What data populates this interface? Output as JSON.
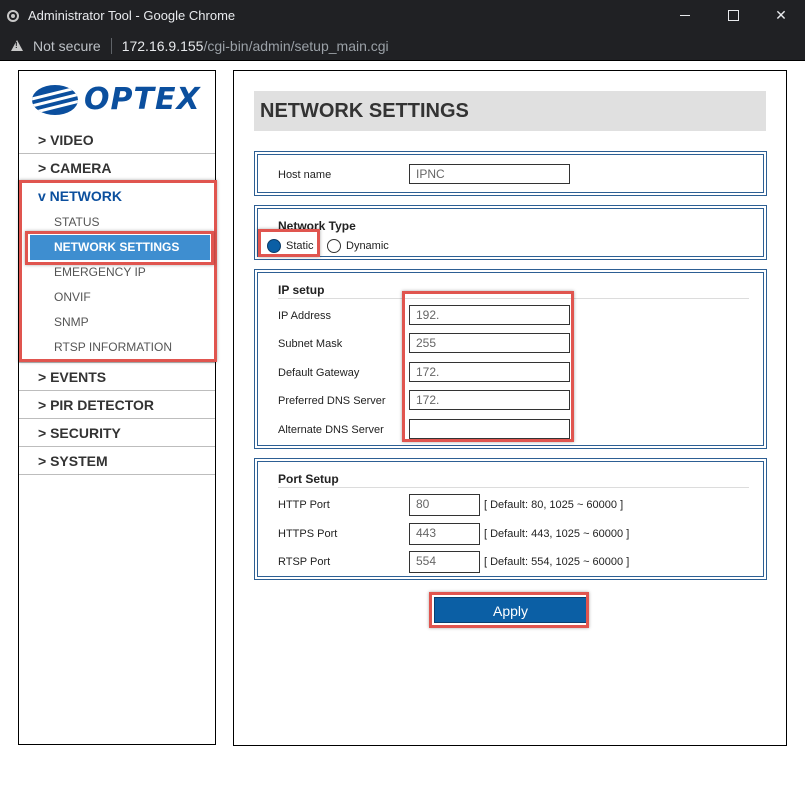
{
  "window": {
    "title": "Administrator Tool - Google Chrome",
    "security_label": "Not secure",
    "url_host": "172.16.9.155",
    "url_path": "/cgi-bin/admin/setup_main.cgi"
  },
  "logo": {
    "text": "OPTEX",
    "icon": "optex-globe-icon"
  },
  "nav": {
    "video": "> VIDEO",
    "camera": "> CAMERA",
    "network": "v NETWORK",
    "network_sub": {
      "status": "STATUS",
      "network_settings": "NETWORK SETTINGS",
      "emergency_ip": "EMERGENCY IP",
      "onvif": "ONVIF",
      "snmp": "SNMP",
      "rtsp_information": "RTSP INFORMATION"
    },
    "events": "> EVENTS",
    "pir_detector": "> PIR DETECTOR",
    "security": "> SECURITY",
    "system": "> SYSTEM"
  },
  "page": {
    "title": "NETWORK SETTINGS"
  },
  "host": {
    "label": "Host name",
    "value": "IPNC"
  },
  "network_type": {
    "legend": "Network Type",
    "static_label": "Static",
    "dynamic_label": "Dynamic",
    "selected": "Static"
  },
  "ip_setup": {
    "legend": "IP setup",
    "ip_address_label": "IP Address",
    "ip_address_value": "192.",
    "subnet_mask_label": "Subnet Mask",
    "subnet_mask_value": "255",
    "default_gateway_label": "Default Gateway",
    "default_gateway_value": "172.",
    "preferred_dns_label": "Preferred DNS Server",
    "preferred_dns_value": "172.",
    "alternate_dns_label": "Alternate DNS Server",
    "alternate_dns_value": ""
  },
  "port_setup": {
    "legend": "Port Setup",
    "http_label": "HTTP Port",
    "http_value": "80",
    "http_hint": "[ Default: 80, 1025 ~ 60000 ]",
    "https_label": "HTTPS Port",
    "https_value": "443",
    "https_hint": "[ Default: 443, 1025 ~ 60000 ]",
    "rtsp_label": "RTSP Port",
    "rtsp_value": "554",
    "rtsp_hint": "[ Default: 554, 1025 ~ 60000 ]"
  },
  "apply_label": "Apply",
  "colors": {
    "brand": "#0b4f9e",
    "selected_nav": "#3e8ed0",
    "apply": "#0b5fa5",
    "highlight": "#e0554f"
  }
}
